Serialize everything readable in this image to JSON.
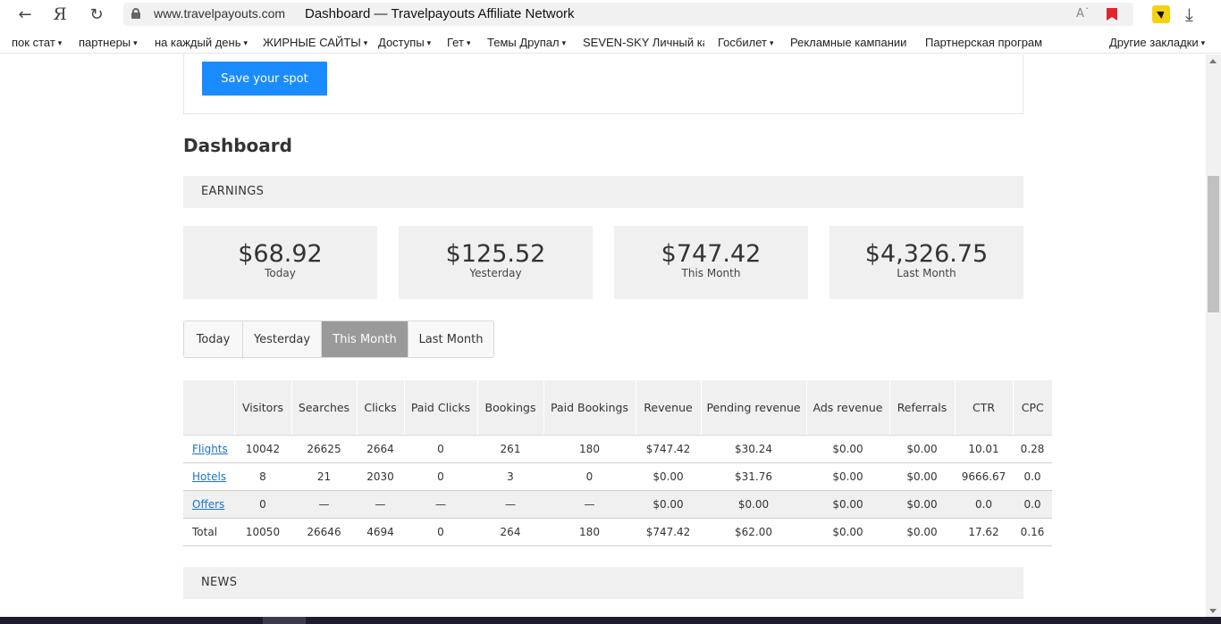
{
  "browser": {
    "domain": "www.travelpayouts.com",
    "page_title": "Dashboard — Travelpayouts Affiliate Network",
    "logo_glyph": "Я"
  },
  "bookmarks": [
    {
      "label": "пок стат",
      "caret": "▾"
    },
    {
      "label": "партнеры",
      "caret": "▾"
    },
    {
      "label": "на каждый день",
      "caret": "▾"
    },
    {
      "label": "ЖИРНЫЕ САЙТЫ",
      "caret": "▾"
    },
    {
      "label": "Доступы",
      "caret": "▾"
    },
    {
      "label": "Гет",
      "caret": "▾"
    },
    {
      "label": "Темы Друпал",
      "caret": "▾"
    },
    {
      "label": "SEVEN-SKY Личный ка",
      "caret": ""
    },
    {
      "label": "Госбилет",
      "caret": "▾"
    },
    {
      "label": "Рекламные кампании",
      "caret": ""
    },
    {
      "label": "Партнерская програм",
      "caret": ""
    },
    {
      "label": "Другие закладки",
      "caret": "▾"
    }
  ],
  "promo": {
    "button_label": "Save your spot"
  },
  "dashboard": {
    "title": "Dashboard",
    "earnings_heading": "EARNINGS",
    "news_heading": "NEWS",
    "cards": [
      {
        "amount": "$68.92",
        "label": "Today"
      },
      {
        "amount": "$125.52",
        "label": "Yesterday"
      },
      {
        "amount": "$747.42",
        "label": "This Month"
      },
      {
        "amount": "$4,326.75",
        "label": "Last Month"
      }
    ],
    "tabs": [
      {
        "label": "Today",
        "active": false
      },
      {
        "label": "Yesterday",
        "active": false
      },
      {
        "label": "This Month",
        "active": true
      },
      {
        "label": "Last Month",
        "active": false
      }
    ]
  },
  "table": {
    "headers": [
      "",
      "Visitors",
      "Searches",
      "Clicks",
      "Paid Clicks",
      "Bookings",
      "Paid Bookings",
      "Revenue",
      "Pending revenue",
      "Ads revenue",
      "Referrals",
      "CTR",
      "CPC"
    ],
    "rows": [
      {
        "label": "Flights",
        "link": true,
        "cells": [
          "10042",
          "26625",
          "2664",
          "0",
          "261",
          "180",
          "$747.42",
          "$30.24",
          "$0.00",
          "$0.00",
          "10.01",
          "0.28"
        ]
      },
      {
        "label": "Hotels",
        "link": true,
        "cells": [
          "8",
          "21",
          "2030",
          "0",
          "3",
          "0",
          "$0.00",
          "$31.76",
          "$0.00",
          "$0.00",
          "9666.67",
          "0.0"
        ]
      },
      {
        "label": "Offers",
        "link": true,
        "cells": [
          "0",
          "—",
          "—",
          "—",
          "—",
          "—",
          "$0.00",
          "$0.00",
          "$0.00",
          "$0.00",
          "0.0",
          "0.0"
        ]
      },
      {
        "label": "Total",
        "link": false,
        "cells": [
          "10050",
          "26646",
          "4694",
          "0",
          "264",
          "180",
          "$747.42",
          "$62.00",
          "$0.00",
          "$0.00",
          "17.62",
          "0.16"
        ]
      }
    ]
  },
  "colors": {
    "accent": "#1a8cff",
    "active_tab": "#9a9a9a",
    "panel_bg": "#f0f0f0",
    "link": "#1a73c9"
  }
}
